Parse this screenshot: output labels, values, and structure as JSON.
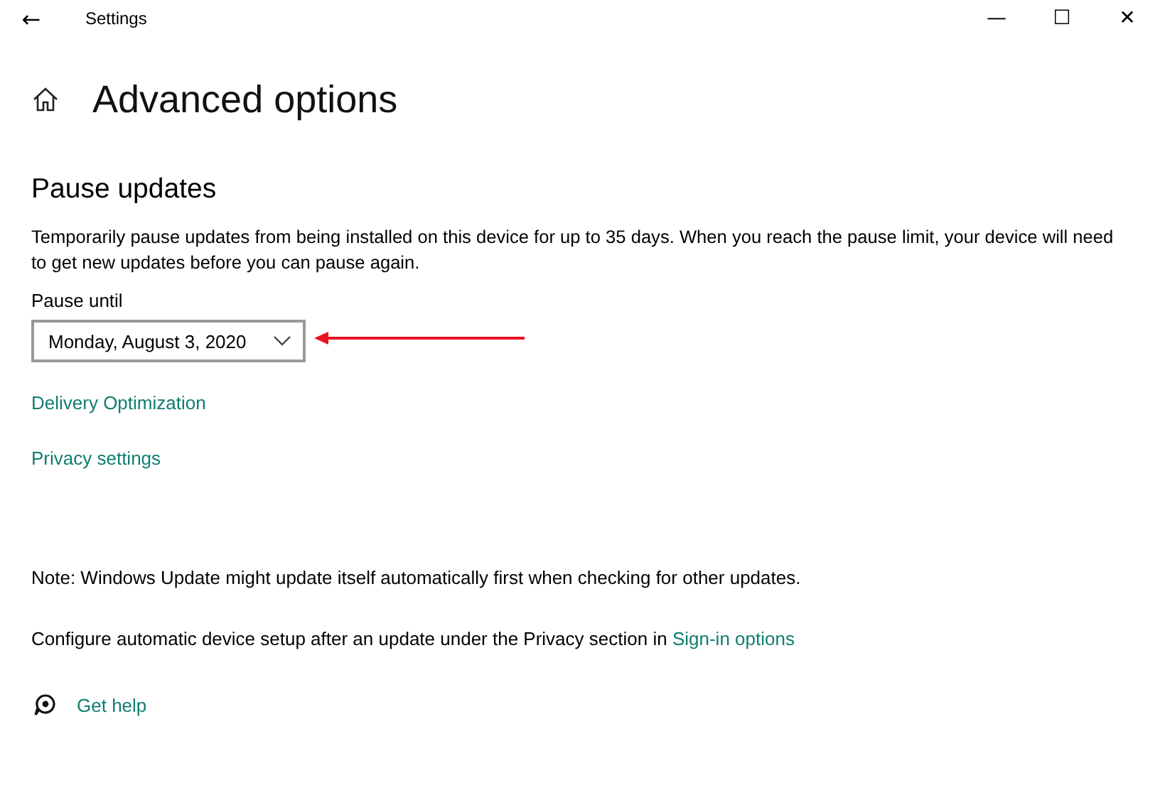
{
  "window": {
    "title": "Settings",
    "back": "←",
    "controls": [
      "—",
      "☐",
      "✕"
    ]
  },
  "page": {
    "title": "Advanced options"
  },
  "pause_updates": {
    "heading": "Pause updates",
    "description": "Temporarily pause updates from being installed on this device for up to 35 days. When you reach the pause limit, your device will need to get new updates before you can pause again.",
    "label": "Pause until",
    "dropdown": {
      "value": "Monday, August 3, 2020"
    }
  },
  "links": [
    "Delivery Optimization",
    "Privacy settings"
  ],
  "note": "Note: Windows Update might update itself automatically first when checking for other updates.",
  "configure": {
    "text": "Configure automatic device setup after an update under the Privacy section in",
    "link": "Sign-in options"
  },
  "help": {
    "label": "Get help"
  }
}
